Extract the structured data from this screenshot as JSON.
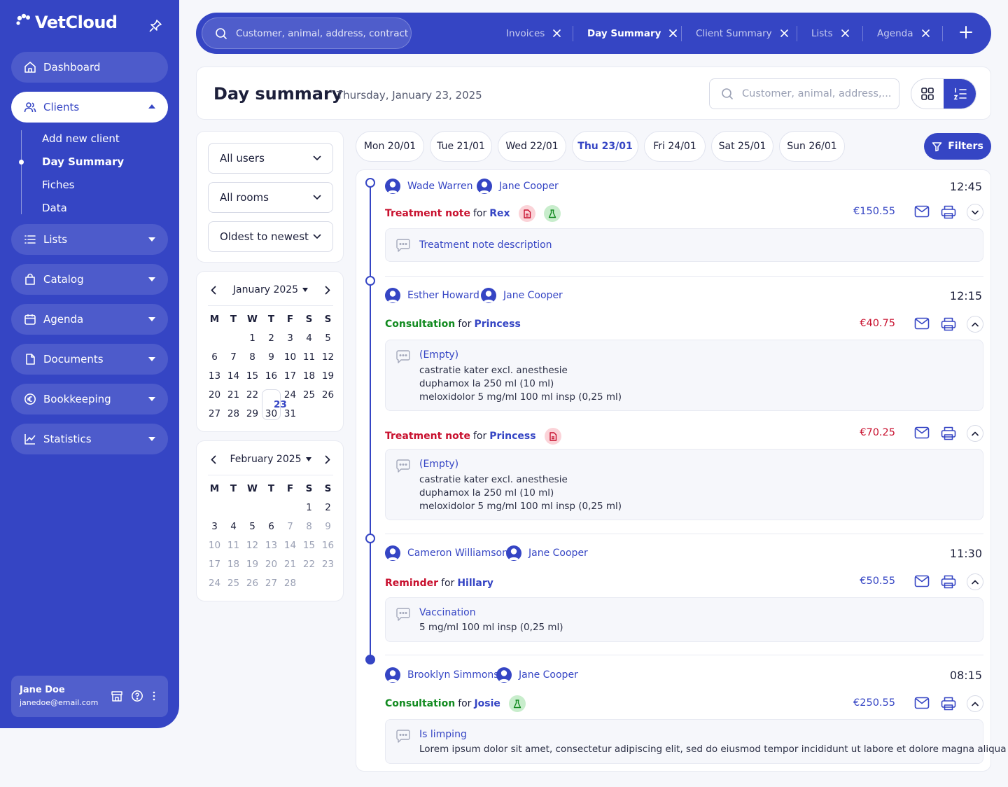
{
  "app": {
    "name": "VetCloud"
  },
  "sidebar": {
    "items": [
      {
        "label": "Dashboard"
      },
      {
        "label": "Clients"
      },
      {
        "label": "Lists"
      },
      {
        "label": "Catalog"
      },
      {
        "label": "Agenda"
      },
      {
        "label": "Documents"
      },
      {
        "label": "Bookkeeping"
      },
      {
        "label": "Statistics"
      }
    ],
    "clients_sub": [
      "Add new client",
      "Day Summary",
      "Fiches",
      "Data"
    ],
    "user": {
      "name": "Jane Doe",
      "email": "janedoe@email.com"
    }
  },
  "topbar": {
    "search_placeholder": "Customer, animal, address, contract",
    "tabs": [
      "Invoices",
      "Day Summary",
      "Client Summary",
      "Lists",
      "Agenda"
    ],
    "active_tab": "Day Summary"
  },
  "header": {
    "title": "Day summary",
    "date": "Thursday, January 23, 2025",
    "search_placeholder": "Customer, animal, address,..."
  },
  "filters": {
    "users": "All users",
    "rooms": "All rooms",
    "sort": "Oldest to newest",
    "button": "Filters"
  },
  "calendar": {
    "dow": [
      "M",
      "T",
      "W",
      "T",
      "F",
      "S",
      "S"
    ],
    "months": [
      {
        "label": "January 2025",
        "selected_day": "23"
      },
      {
        "label": "February 2025"
      }
    ]
  },
  "week": [
    "Mon 20/01",
    "Tue 21/01",
    "Wed 22/01",
    "Thu 23/01",
    "Fri 24/01",
    "Sat 25/01",
    "Sun 26/01"
  ],
  "active_day": "Thu 23/01",
  "timeline": [
    {
      "client": "Wade Warren",
      "vet": "Jane Cooper",
      "time": "12:45",
      "entries": [
        {
          "type": "Treatment note",
          "for": "for",
          "pet": "Rex",
          "price": "€150.55",
          "note": {
            "title": "Treatment note description",
            "lines": []
          }
        }
      ]
    },
    {
      "client": "Esther Howard",
      "vet": "Jane Cooper",
      "time": "12:15",
      "entries": [
        {
          "type": "Consultation",
          "for": "for",
          "pet": "Princess",
          "price": "€40.75",
          "note": {
            "title": "(Empty)",
            "lines": [
              "castratie kater excl. anesthesie",
              "duphamox la 250 ml (10 ml)",
              "meloxidolor 5 mg/ml 100 ml insp (0,25 ml)"
            ]
          }
        },
        {
          "type": "Treatment note",
          "for": "for",
          "pet": "Princess",
          "price": "€70.25",
          "note": {
            "title": "(Empty)",
            "lines": [
              "castratie kater excl. anesthesie",
              "duphamox la 250 ml (10 ml)",
              "meloxidolor 5 mg/ml 100 ml insp (0,25 ml)"
            ]
          }
        }
      ]
    },
    {
      "client": "Cameron Williamson",
      "vet": "Jane Cooper",
      "time": "11:30",
      "entries": [
        {
          "type": "Reminder",
          "for": "for",
          "pet": "Hillary",
          "price": "€50.55",
          "note": {
            "title": "Vaccination",
            "lines": [
              "5 mg/ml 100 ml insp (0,25 ml)"
            ]
          }
        }
      ]
    },
    {
      "client": "Brooklyn Simmons",
      "vet": "Jane Cooper",
      "time": "08:15",
      "entries": [
        {
          "type": "Consultation",
          "for": "for",
          "pet": "Josie",
          "price": "€250.55",
          "note": {
            "title": "Is limping",
            "lines": [
              "Lorem ipsum dolor sit amet, consectetur adipiscing elit, sed do eiusmod tempor incididunt ut labore et dolore magna aliqua"
            ]
          }
        }
      ]
    }
  ],
  "colors": {
    "brand": "#3545c4",
    "red": "#c8102e",
    "green": "#118a1f",
    "bg": "#f6f7fb"
  }
}
